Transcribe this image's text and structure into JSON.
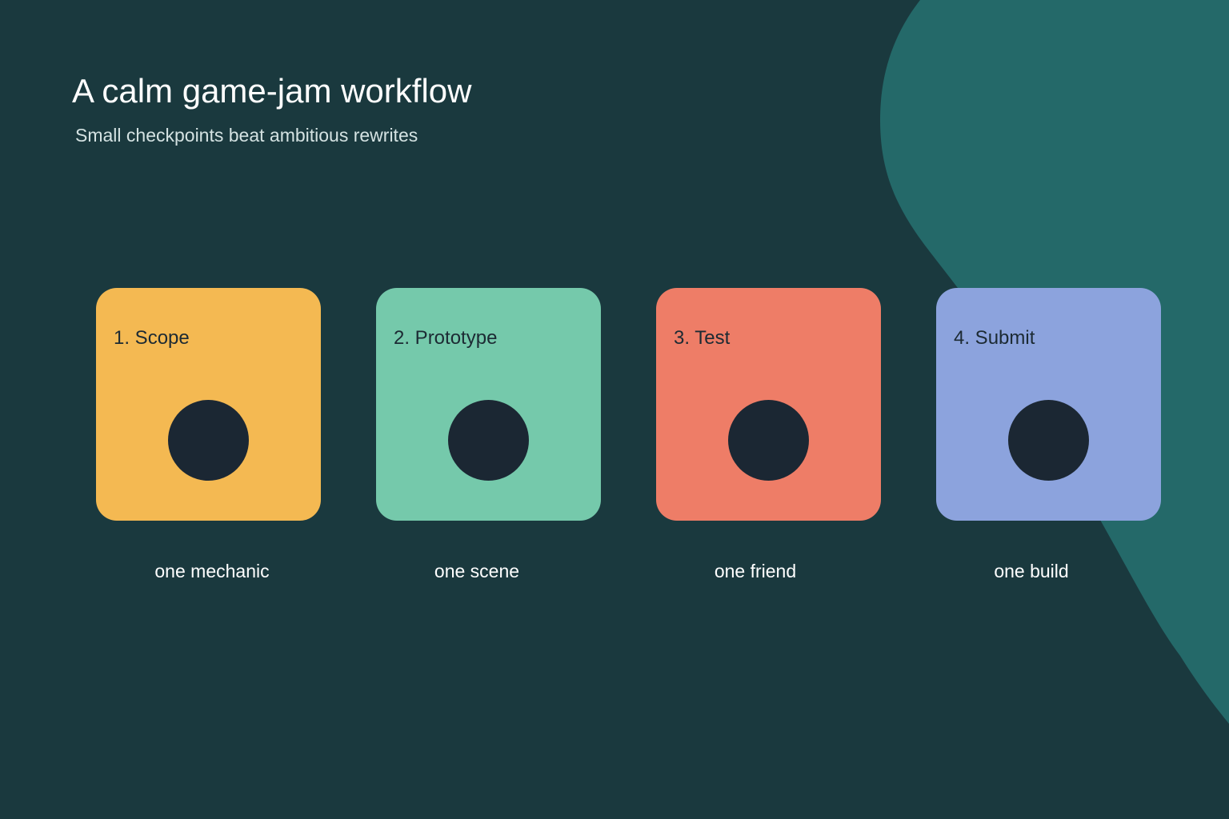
{
  "colors": {
    "background": "#1a393e",
    "accent_blob": "#246969",
    "dot": "#1b2733"
  },
  "header": {
    "title": "A calm game-jam workflow",
    "subtitle": "Small checkpoints beat ambitious rewrites"
  },
  "steps": [
    {
      "label": "1. Scope",
      "caption": "one mechanic",
      "color": "#f4b952"
    },
    {
      "label": "2. Prototype",
      "caption": "one scene",
      "color": "#75c9ab"
    },
    {
      "label": "3. Test",
      "caption": "one friend",
      "color": "#ee7d67"
    },
    {
      "label": "4. Submit",
      "caption": "one build",
      "color": "#8ca3dd"
    }
  ]
}
